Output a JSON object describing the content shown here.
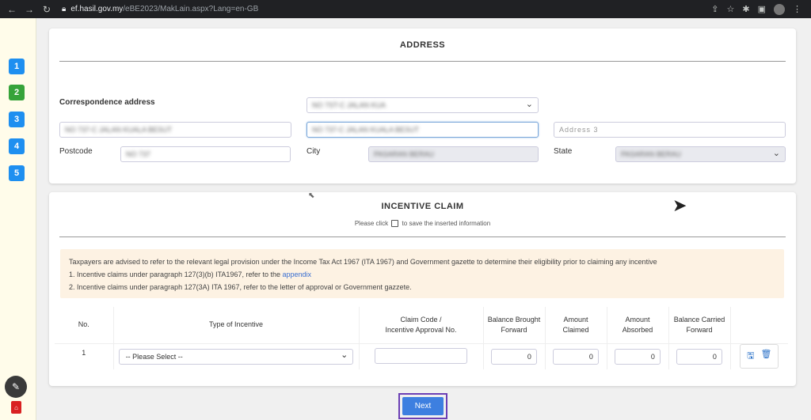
{
  "browser": {
    "url_domain": "ef.hasil.gov.my",
    "url_path": "/eBE2023/MakLain.aspx?Lang=en-GB"
  },
  "sidebar": {
    "steps": [
      "1",
      "2",
      "3",
      "4",
      "5"
    ],
    "active_step": "2"
  },
  "address": {
    "title": "ADDRESS",
    "correspondence_label": "Correspondence address",
    "address_select_value": "NO 7ST-C JALAN KUA",
    "address1_value": "NO 737-C JALAN KUALA BESUT",
    "address2_value": "NO 737-C JALAN KUALA BESUT",
    "address3_placeholder": "Address 3",
    "postcode_label": "Postcode",
    "postcode_value": "NO 737",
    "city_label": "City",
    "city_value": "PASARAN BERAU",
    "state_label": "State",
    "state_value": "PASARAN BERAU"
  },
  "incentive": {
    "title": "INCENTIVE CLAIM",
    "hint_before": "Please click",
    "hint_after": "to save the inserted information",
    "notice_line1": "Taxpayers are advised to refer to the relevant legal provision under the Income Tax Act 1967 (ITA 1967) and Government gazette to determine their eligibility prior to claiming any incentive",
    "notice_line2_prefix": "1. Incentive claims under paragraph 127(3)(b) ITA1967, refer to the",
    "notice_line2_link": "appendix",
    "notice_line3": "2. Incentive claims under paragraph 127(3A) ITA 1967, refer to the letter of approval or Government gazzete.",
    "columns": {
      "no": "No.",
      "type": "Type of Incentive",
      "claim_code_1": "Claim Code /",
      "claim_code_2": "Incentive Approval No.",
      "bbf_1": "Balance Brought",
      "bbf_2": "Forward",
      "claimed_1": "Amount",
      "claimed_2": "Claimed",
      "absorbed_1": "Amount",
      "absorbed_2": "Absorbed",
      "bcf_1": "Balance Carried",
      "bcf_2": "Forward"
    },
    "rows": [
      {
        "no": "1",
        "type": "-- Please Select --",
        "claim_code": "",
        "balance_brought_forward": "0",
        "amount_claimed": "0",
        "amount_absorbed": "0",
        "balance_carried_forward": "0"
      }
    ]
  },
  "footer": {
    "next_label": "Next"
  },
  "icons": {
    "save": "save-icon",
    "delete": "trash-icon",
    "pen": "pencil-icon",
    "pdf": "pdf-icon"
  }
}
